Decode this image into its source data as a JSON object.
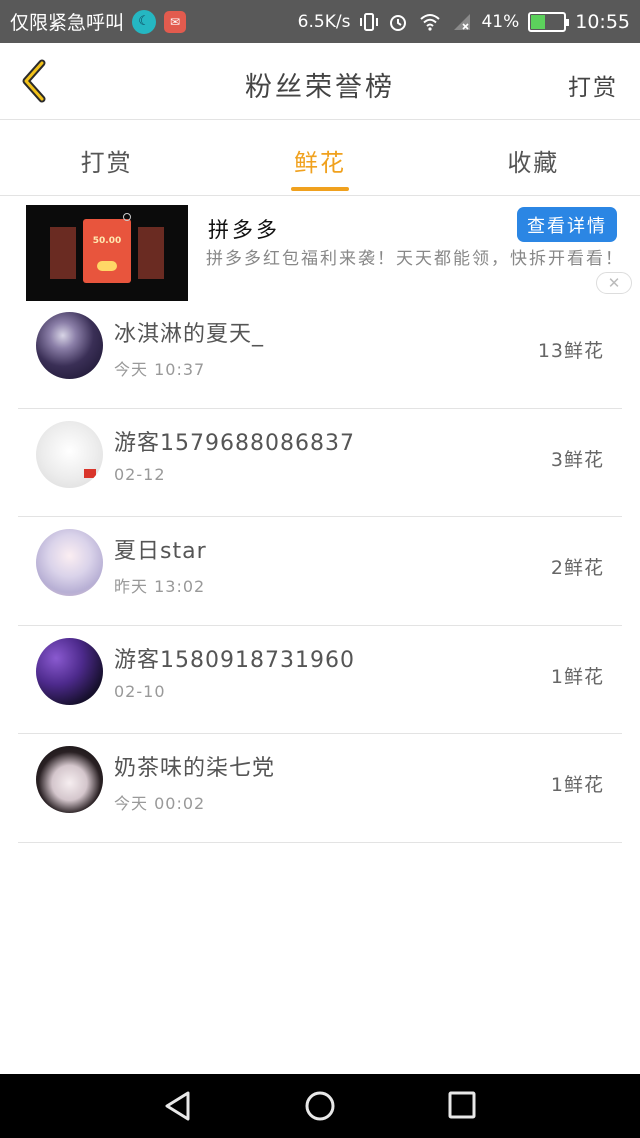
{
  "status_bar": {
    "carrier_text": "仅限紧急呼叫",
    "net_speed": "6.5K/s",
    "battery_percent": "41%",
    "time": "10:55",
    "battery_level": 0.41,
    "icons": [
      "moon-app-icon",
      "mail-app-icon",
      "vibrate-icon",
      "alarm-icon",
      "wifi-icon",
      "signal-icon",
      "battery-icon"
    ]
  },
  "header": {
    "back_icon": "chevron-left-icon",
    "title": "粉丝荣誉榜",
    "action": "打赏"
  },
  "tabs": [
    {
      "label": "打赏",
      "active": false
    },
    {
      "label": "鲜花",
      "active": true
    },
    {
      "label": "收藏",
      "active": false
    }
  ],
  "ad": {
    "card_amount": "50.00",
    "title": "拼多多",
    "cta": "查看详情",
    "description": "拼多多红包福利来袭！天天都能领，快拆开看看！",
    "close_icon": "close-icon"
  },
  "rows": [
    {
      "name": "冰淇淋的夏天_",
      "time": "今天 10:37",
      "count": "13鲜花"
    },
    {
      "name": "游客1579688086837",
      "time": "02-12",
      "count": "3鲜花"
    },
    {
      "name": "夏日star",
      "time": "昨天 13:02",
      "count": "2鲜花"
    },
    {
      "name": "游客1580918731960",
      "time": "02-10",
      "count": "1鲜花"
    },
    {
      "name": "奶茶味的柒七党",
      "time": "今天 00:02",
      "count": "1鲜花"
    }
  ],
  "nav": {
    "icons": [
      "nav-back-icon",
      "nav-home-icon",
      "nav-recent-icon"
    ]
  },
  "colors": {
    "accent": "#f0a11e",
    "cta_blue": "#2b86e4",
    "status_bar": "#595959"
  }
}
